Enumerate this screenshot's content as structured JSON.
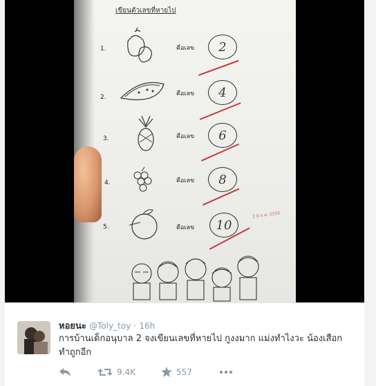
{
  "photo": {
    "heading": "เขียนตัวเลขที่หายไป",
    "rows": [
      {
        "num": "1.",
        "keyword": "คือเลข",
        "answer": "2"
      },
      {
        "num": "2.",
        "keyword": "คือเลข",
        "answer": "4"
      },
      {
        "num": "3.",
        "keyword": "คือเลข",
        "answer": "6"
      },
      {
        "num": "4.",
        "keyword": "คือเลข",
        "answer": "8"
      },
      {
        "num": "5.",
        "keyword": "คือเลข",
        "answer": "10"
      }
    ],
    "stamp": "2 8 ส.ค. 2558",
    "tick_color": "#c23b3b"
  },
  "tweet": {
    "name": "หอยนะ",
    "handle": "@Toly_toy",
    "separator": "·",
    "time": "16h",
    "text_line1": "การบ้านเด็กอนุบาล 2 จงเขียนเลขที่หายไป กูงงมาก แม่งทำไงวะ น้องเสือก",
    "text_line2": "ทำถูกอีก",
    "retweets": "9.4K",
    "favorites": "557",
    "icons": {
      "reply": "reply-icon",
      "retweet": "retweet-icon",
      "favorite": "star-icon",
      "more": "more-icon"
    },
    "muted_color": "#8899a6"
  }
}
